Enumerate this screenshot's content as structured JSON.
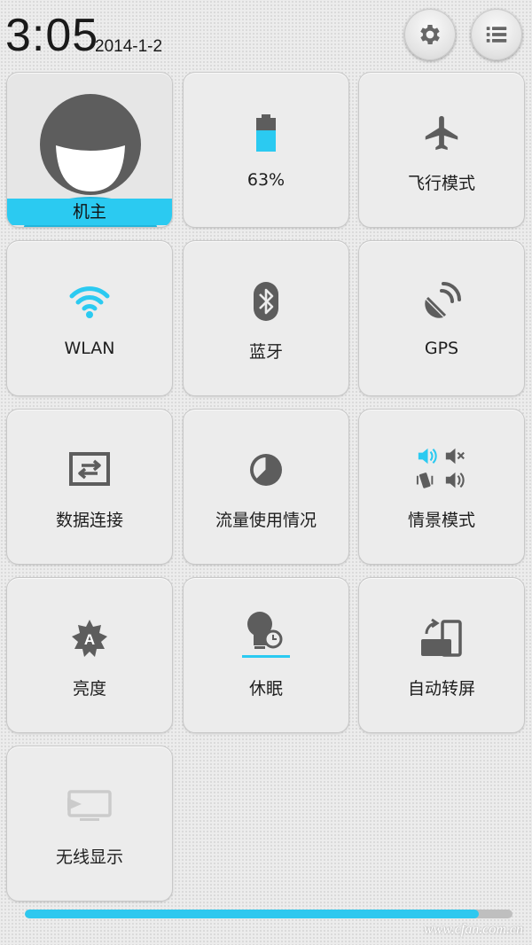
{
  "status": {
    "time": "3:05",
    "date": "2014-1-2"
  },
  "header": {
    "settings_icon": "gear-icon",
    "menu_icon": "list-icon"
  },
  "tiles": [
    {
      "id": "owner",
      "label": "机主",
      "icon": "avatar-icon"
    },
    {
      "id": "battery",
      "label": "63%",
      "icon": "battery-icon",
      "level": 0.63
    },
    {
      "id": "airplane",
      "label": "飞行模式",
      "icon": "airplane-icon"
    },
    {
      "id": "wlan",
      "label": "WLAN",
      "icon": "wifi-icon",
      "active": true
    },
    {
      "id": "bluetooth",
      "label": "蓝牙",
      "icon": "bluetooth-icon"
    },
    {
      "id": "gps",
      "label": "GPS",
      "icon": "gps-icon"
    },
    {
      "id": "data",
      "label": "数据连接",
      "icon": "data-transfer-icon"
    },
    {
      "id": "traffic",
      "label": "流量使用情况",
      "icon": "data-usage-icon"
    },
    {
      "id": "profile",
      "label": "情景模式",
      "icon": "sound-profile-icon"
    },
    {
      "id": "brightness",
      "label": "亮度",
      "icon": "brightness-icon"
    },
    {
      "id": "sleep",
      "label": "休眠",
      "icon": "sleep-icon"
    },
    {
      "id": "rotate",
      "label": "自动转屏",
      "icon": "screen-rotate-icon"
    },
    {
      "id": "display",
      "label": "无线显示",
      "icon": "wireless-display-icon"
    }
  ],
  "colors": {
    "accent": "#2bcaf1",
    "icon_gray": "#5d5d5d",
    "background": "#ececec"
  },
  "watermark": "www.cfan.com.cn",
  "progress": {
    "fraction": 0.93
  }
}
